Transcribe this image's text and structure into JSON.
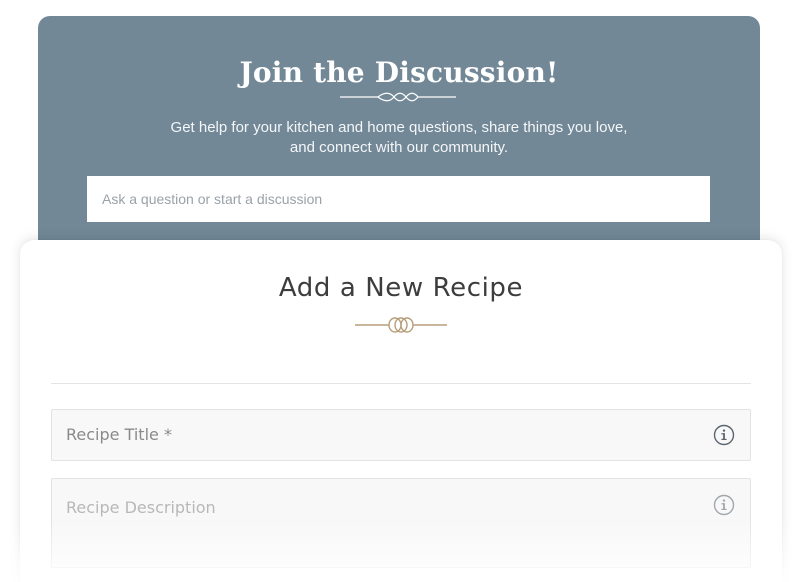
{
  "discussion": {
    "title": "Join the Discussion!",
    "subtitle_line1": "Get help for your kitchen and home questions, share things you love,",
    "subtitle_line2": "and connect with our community.",
    "input_placeholder": "Ask a question or start a discussion",
    "card_color": "#728897"
  },
  "recipe": {
    "title": "Add a New Recipe",
    "fields": [
      {
        "label": "Recipe Title *",
        "icon": "info-icon"
      },
      {
        "label": "Recipe Description",
        "icon": "info-icon"
      }
    ],
    "accent_color": "#b89d7a"
  }
}
